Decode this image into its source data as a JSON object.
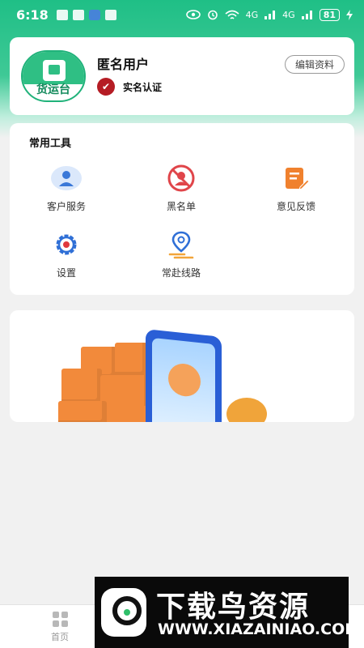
{
  "status_bar": {
    "time": "6:18",
    "signal1": "4G",
    "signal2": "4G",
    "battery": "81"
  },
  "profile": {
    "logo_text": "货运台",
    "username": "匿名用户",
    "verify_label": "实名认证",
    "edit_button": "编辑资料"
  },
  "tools": {
    "title": "常用工具",
    "items": [
      {
        "label": "客户服务",
        "icon": "customer-service-icon"
      },
      {
        "label": "黑名单",
        "icon": "blacklist-icon"
      },
      {
        "label": "意见反馈",
        "icon": "feedback-icon"
      },
      {
        "label": "设置",
        "icon": "settings-icon"
      },
      {
        "label": "常赴线路",
        "icon": "route-icon"
      }
    ]
  },
  "bottom_nav": {
    "home_label": "首页"
  },
  "watermark": {
    "title": "下载鸟资源",
    "url": "WWW.XIAZAINIAO.COM"
  },
  "colors": {
    "brand_green": "#1fbf86",
    "accent_orange": "#f28a3b",
    "verify_red": "#b51c24"
  }
}
